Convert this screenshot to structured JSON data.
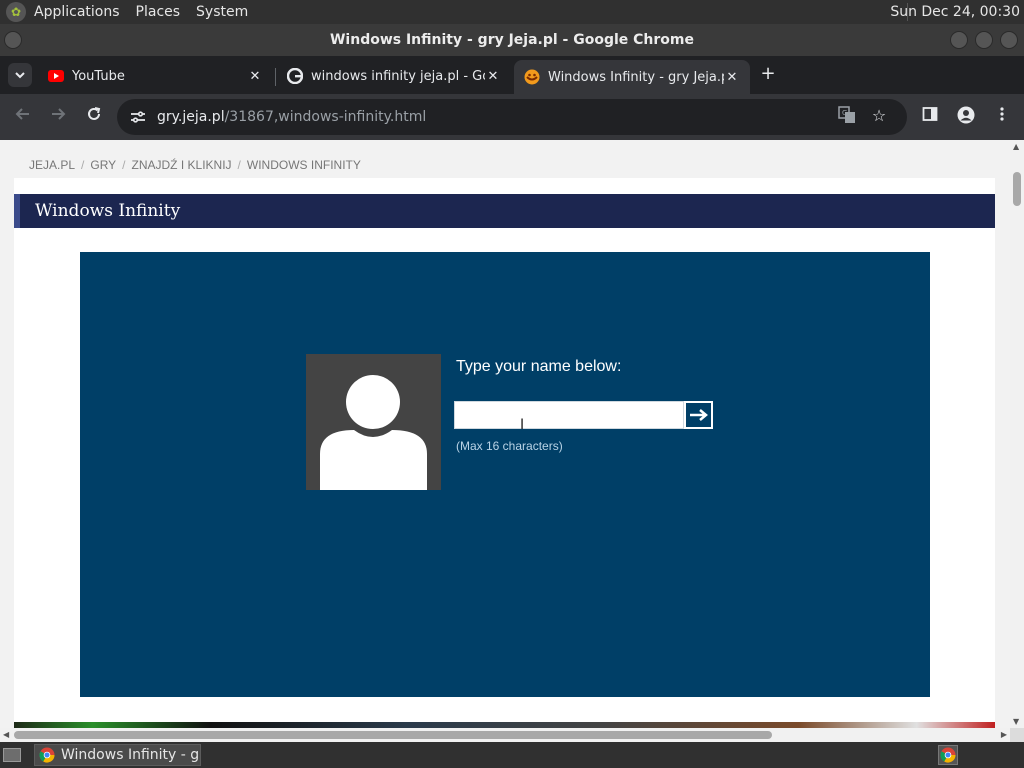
{
  "panel": {
    "menus": [
      "Applications",
      "Places",
      "System"
    ],
    "clock": "Sun Dec 24, 00:30"
  },
  "window": {
    "title": "Windows Infinity - gry Jeja.pl - Google Chrome"
  },
  "tabs": [
    {
      "title": "YouTube",
      "favicon": "youtube-icon"
    },
    {
      "title": "windows infinity jeja.pl - Google",
      "favicon": "google-icon"
    },
    {
      "title": "Windows Infinity - gry Jeja.pl",
      "favicon": "jeja-icon",
      "active": true
    }
  ],
  "toolbar": {
    "url_host": "gry.jeja.pl",
    "url_path": "/31867,windows-infinity.html"
  },
  "page": {
    "breadcrumb": [
      "JEJA.PL",
      "GRY",
      "ZNAJDŹ I KLIKNIJ",
      "WINDOWS INFINITY"
    ],
    "breadcrumb_sep": "/",
    "header_title": "Windows Infinity",
    "game": {
      "prompt": "Type your name below:",
      "name_value": "",
      "hint": "(Max 16 characters)",
      "background": "#003f67"
    }
  },
  "taskbar": {
    "task_label": "Windows Infinity - g..."
  },
  "colors": {
    "header_bg": "#1c2650",
    "game_bg": "#003f67",
    "tab_active": "#35363a",
    "tabstrip": "#202124"
  }
}
